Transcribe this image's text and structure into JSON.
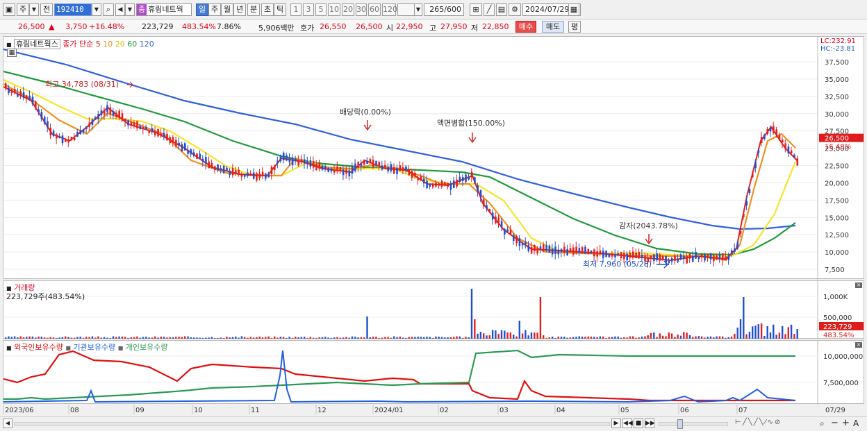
{
  "toolbar": {
    "market_label": "주",
    "market_prev": "전",
    "code": "192410",
    "name_tag": "종",
    "name": "휴림네트웍",
    "periods": [
      "일",
      "주",
      "월",
      "년",
      "분",
      "초",
      "틱"
    ],
    "active_period": "일",
    "intervals": [
      "1",
      "3",
      "5",
      "10",
      "20",
      "30",
      "60",
      "120"
    ],
    "count": "265",
    "count_total": "/600",
    "date": "2024/07/29"
  },
  "quote": {
    "price": "26,500",
    "change": "3,750",
    "change_pct": "+16.48%",
    "volume": "223,729",
    "volume_pct": "483.54%",
    "turnover_pct": "7.86%",
    "amount": "5,906백만",
    "bid_label": "호가",
    "ask": "26,550",
    "bid": "26,500",
    "open_label": "시",
    "open": "22,950",
    "high_label": "고",
    "high": "27,950",
    "low_label": "저",
    "low": "22,850",
    "buy_label": "매수",
    "sell_label": "매도",
    "avg_label": "평"
  },
  "price_panel": {
    "title": "휴림네트웍스",
    "ma_label": "종가 단순",
    "ma_periods": [
      "5",
      "10",
      "20",
      "60",
      "120"
    ],
    "lc_label": "LC:232.91",
    "hc_label": "HC:-23.81",
    "current_price_label": "26,500",
    "current_pct_label": "16.48%",
    "y_ticks": [
      "37,500",
      "35,000",
      "32,500",
      "30,000",
      "27,500",
      "25,000",
      "22,500",
      "20,000",
      "17,500",
      "15,000",
      "12,500",
      "10,000",
      "7,500"
    ],
    "annotations": {
      "high_note": "최고 34,783 (08/31)",
      "dividend": "배당락(0.00%)",
      "merge": "액면병합(150.00%)",
      "reduction": "감자(2043.78%)",
      "low_note": "최저 7,960 (05/28)"
    },
    "colors": {
      "ma5": "#e02020",
      "ma10": "#f0901e",
      "ma20": "#f5e52a",
      "ma60": "#1f9a3a",
      "ma120": "#3060e0"
    }
  },
  "volume_panel": {
    "title": "거래량",
    "value_label": "223,729주(483.54%)",
    "y_ticks": [
      "1,000K",
      "500,000"
    ],
    "current_label": "223,729",
    "current_pct": "483.54%"
  },
  "own_panel": {
    "legend": [
      "외국인보유수량",
      "기관보유수량",
      "개인보유수량"
    ],
    "y_ticks": [
      "10,000,000",
      "7,500,000"
    ],
    "colors": [
      "#e01010",
      "#2060e0",
      "#2a9a55"
    ]
  },
  "x_axis": {
    "labels": [
      "2023/06",
      "08",
      "09",
      "10",
      "11",
      "12",
      "2024/01",
      "02",
      "03",
      "04",
      "05",
      "06",
      "07"
    ],
    "end_label": "07/29"
  }
}
